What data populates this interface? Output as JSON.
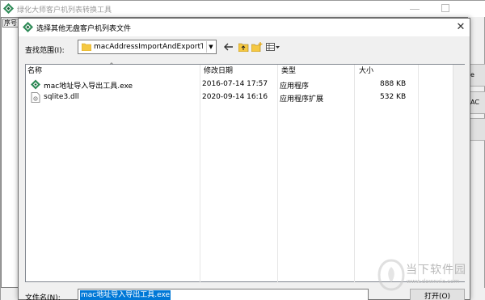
{
  "background_app": {
    "title": "绿化大师客户机列表转换工具",
    "column_header": "序号",
    "side_buttons": [
      "e",
      "AC"
    ]
  },
  "dialog": {
    "title": "选择其他无盘客户机列表文件",
    "look_in_label": "查找范围(I):",
    "look_in_value": "macAddressImportAndExportToo",
    "toolbar_icons": [
      "back-arrow-icon",
      "up-folder-icon",
      "new-folder-icon",
      "view-menu-icon"
    ],
    "columns": [
      "名称",
      "修改日期",
      "类型",
      "大小"
    ],
    "files": [
      {
        "name": "mac地址导入导出工具.exe",
        "modified": "2016-07-14 17:57",
        "type": "应用程序",
        "size": "888 KB",
        "icon": "app-exe-icon"
      },
      {
        "name": "sqlite3.dll",
        "modified": "2020-09-14 16:16",
        "type": "应用程序扩展",
        "size": "532 KB",
        "icon": "dll-file-icon"
      }
    ],
    "filename_label": "文件名(N):",
    "filename_value": "mac地址导入导出工具.exe",
    "open_button": "打开(O)"
  },
  "watermark": {
    "brand": "当下软件园",
    "url": "www.downxia.com"
  },
  "colors": {
    "selection": "#0078d7",
    "app_icon_green": "#2e8b57"
  }
}
